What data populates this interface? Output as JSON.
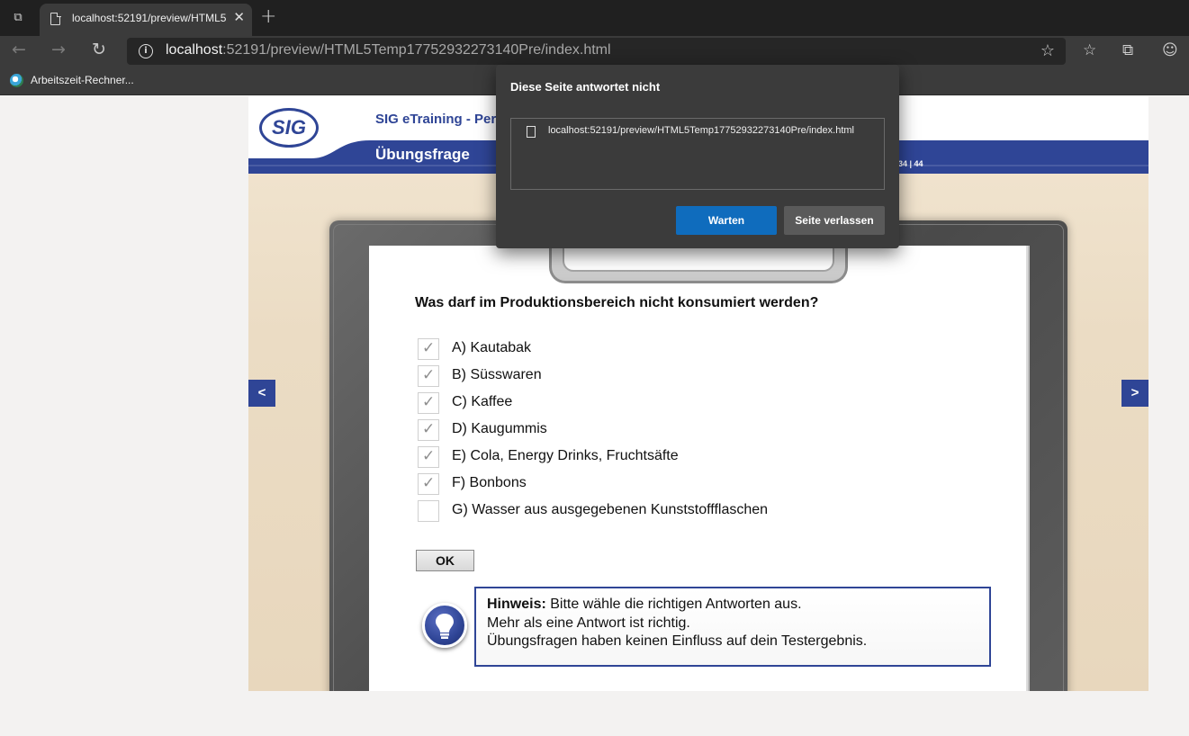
{
  "browser": {
    "tab": {
      "title": "localhost:52191/preview/HTML5"
    },
    "address": {
      "host": "localhost",
      "path": ":52191/preview/HTML5Temp17752932273140Pre/index.html"
    },
    "bookmarks": [
      {
        "label": "Arbeitszeit-Rechner..."
      }
    ]
  },
  "course": {
    "app_title": "SIG eTraining - Per",
    "logo_text": "SIG",
    "section_title": "Übungsfrage",
    "page_counter": "34 | 44",
    "question": "Was darf im Produktionsbereich nicht konsumiert werden?",
    "options": [
      {
        "label": "A) Kautabak",
        "checked": true
      },
      {
        "label": "B) Süsswaren",
        "checked": true
      },
      {
        "label": "C) Kaffee",
        "checked": true
      },
      {
        "label": "D) Kaugummis",
        "checked": true
      },
      {
        "label": "E) Cola, Energy Drinks, Fruchtsäfte",
        "checked": true
      },
      {
        "label": "F) Bonbons",
        "checked": true
      },
      {
        "label": "G) Wasser aus ausgegebenen Kunststoffflaschen",
        "checked": false
      }
    ],
    "ok_label": "OK",
    "hint": {
      "title": "Hinweis:",
      "line1": "Bitte wähle die richtigen Antworten aus.",
      "line2": "Mehr als eine Antwort ist richtig.",
      "line3": "Übungsfragen haben keinen Einfluss auf dein Testergebnis."
    },
    "prev_label": "<",
    "next_label": ">"
  },
  "dialog": {
    "title": "Diese Seite antwortet nicht",
    "page_url": "localhost:52191/preview/HTML5Temp17752932273140Pre/index.html",
    "wait_label": "Warten",
    "leave_label": "Seite verlassen"
  },
  "colors": {
    "brand_blue": "#2f4596",
    "dialog_primary": "#0f6cbd",
    "chrome_dark": "#202020"
  },
  "icons": {
    "tab_actions": "tab-actions-icon",
    "back": "arrow-left-icon",
    "forward": "arrow-right-icon",
    "reload": "reload-icon",
    "site_info": "info-icon",
    "add_favorite": "star-plus-icon",
    "favorites": "favorites-icon",
    "collections": "collections-icon",
    "profile": "profile-icon",
    "hint": "lightbulb-icon"
  }
}
